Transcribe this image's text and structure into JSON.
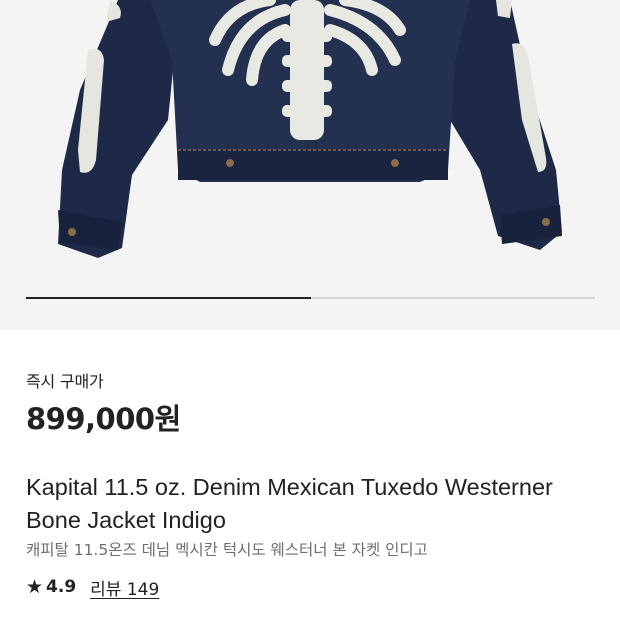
{
  "gallery": {
    "progress": 0.5
  },
  "product": {
    "price_label": "즉시 구매가",
    "price": "899,000원",
    "title": "Kapital 11.5 oz. Denim Mexican Tuxedo Westerner Bone Jacket Indigo",
    "subtitle": "캐피탈 11.5온즈 데님 멕시칸 턱시도 웨스터너 본 자켓 인디고",
    "rating": "4.9",
    "reviews_label": "리뷰 149"
  },
  "icons": {
    "rating": "star-icon"
  },
  "colors": {
    "background": "#f4f4f4",
    "denim": "#1f2a4a",
    "bone": "#e8e8e4"
  }
}
